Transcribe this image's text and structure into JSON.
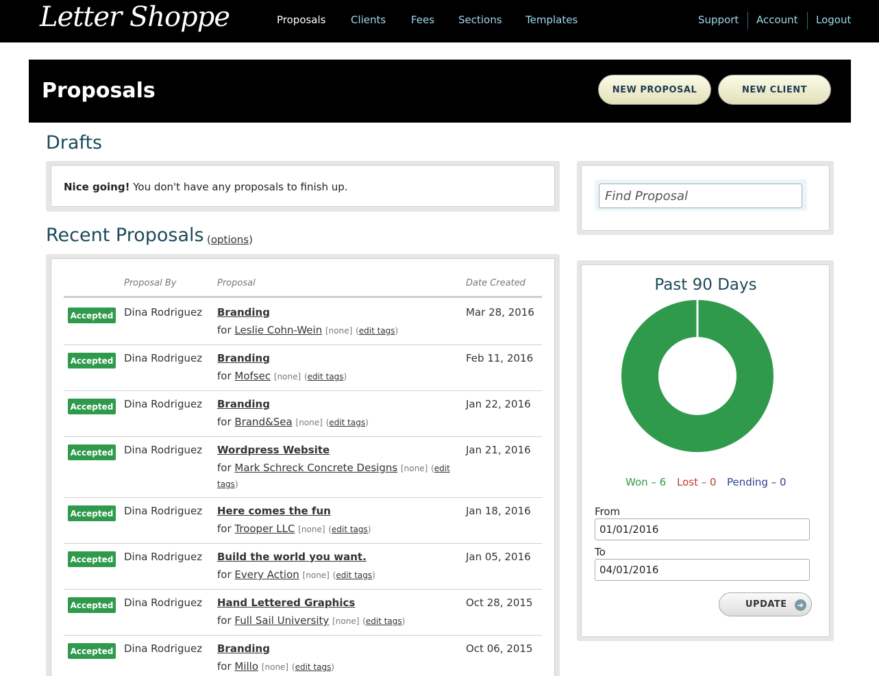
{
  "app": {
    "logo_text": "Letter Shoppe"
  },
  "nav": {
    "items": [
      {
        "label": "Proposals",
        "active": true
      },
      {
        "label": "Clients",
        "active": false
      },
      {
        "label": "Fees",
        "active": false
      },
      {
        "label": "Sections",
        "active": false
      },
      {
        "label": "Templates",
        "active": false
      }
    ],
    "right": [
      {
        "label": "Support"
      },
      {
        "label": "Account"
      },
      {
        "label": "Logout"
      }
    ]
  },
  "header": {
    "title": "Proposals",
    "new_proposal_label": "NEW PROPOSAL",
    "new_client_label": "NEW CLIENT"
  },
  "drafts": {
    "title": "Drafts",
    "message_bold": "Nice going!",
    "message": "You don't have any proposals to finish up."
  },
  "recent": {
    "title": "Recent Proposals",
    "options_label": "options",
    "columns": [
      "Proposal By",
      "Proposal",
      "Date Created"
    ],
    "tags_none": "[none]",
    "edit_tags_label": "edit tags",
    "for_prefix": "for",
    "rows": [
      {
        "status": "Accepted",
        "by": "Dina Rodriguez",
        "proposal": "Branding",
        "client": "Leslie Cohn-Wein",
        "date": "Mar 28, 2016"
      },
      {
        "status": "Accepted",
        "by": "Dina Rodriguez",
        "proposal": "Branding",
        "client": "Mofsec",
        "date": "Feb 11, 2016"
      },
      {
        "status": "Accepted",
        "by": "Dina Rodriguez",
        "proposal": "Branding",
        "client": "Brand&Sea",
        "date": "Jan 22, 2016"
      },
      {
        "status": "Accepted",
        "by": "Dina Rodriguez",
        "proposal": "Wordpress Website",
        "client": "Mark Schreck Concrete Designs",
        "date": "Jan 21, 2016"
      },
      {
        "status": "Accepted",
        "by": "Dina Rodriguez",
        "proposal": "Here comes the fun",
        "client": "Trooper LLC",
        "date": "Jan 18, 2016"
      },
      {
        "status": "Accepted",
        "by": "Dina Rodriguez",
        "proposal": "Build the world you want.",
        "client": "Every Action",
        "date": "Jan 05, 2016"
      },
      {
        "status": "Accepted",
        "by": "Dina Rodriguez",
        "proposal": "Hand Lettered Graphics",
        "client": "Full Sail University",
        "date": "Oct 28, 2015"
      },
      {
        "status": "Accepted",
        "by": "Dina Rodriguez",
        "proposal": "Branding",
        "client": "Millo",
        "date": "Oct 06, 2015"
      }
    ]
  },
  "search": {
    "placeholder": "Find Proposal"
  },
  "stats": {
    "title": "Past 90 Days",
    "won_label": "Won – 6",
    "lost_label": "Lost – 0",
    "pending_label": "Pending – 0",
    "won": 6,
    "lost": 0,
    "pending": 0,
    "colors": {
      "won": "#2f9a4b",
      "lost": "#c0392b",
      "pending": "#2c3e8f"
    },
    "from_label": "From",
    "from_value": "01/01/2016",
    "to_label": "To",
    "to_value": "04/01/2016",
    "update_label": "UPDATE"
  }
}
